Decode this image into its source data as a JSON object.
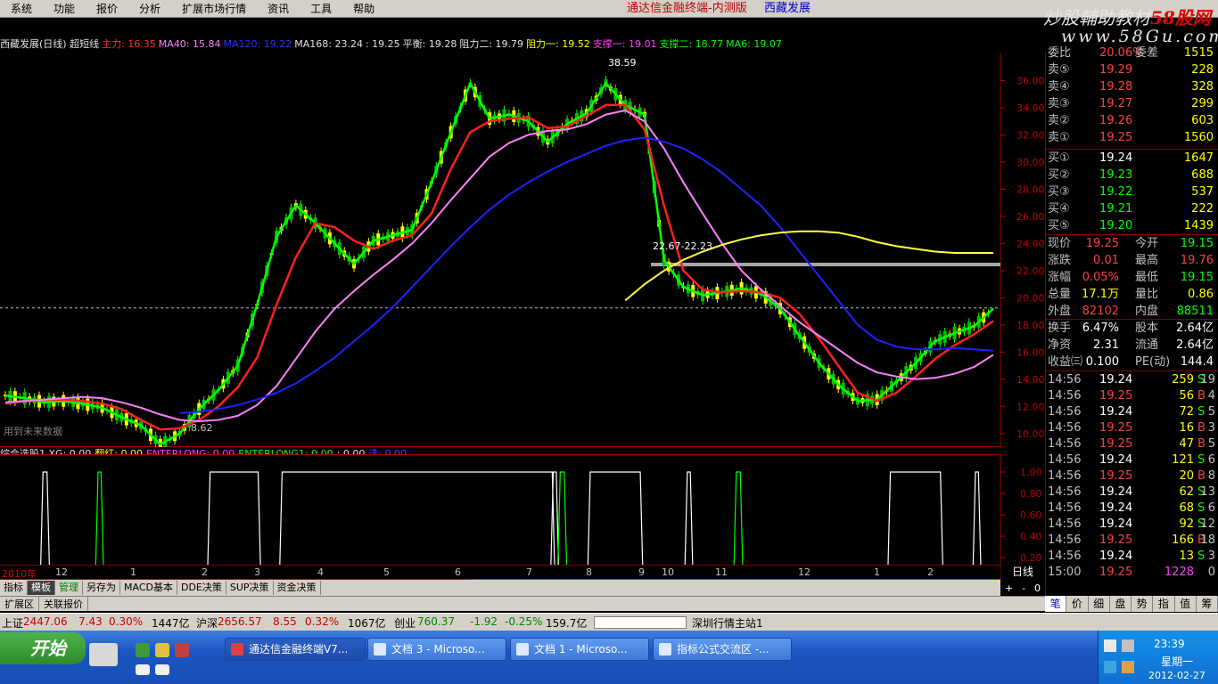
{
  "menu": {
    "items": [
      "系统",
      "功能",
      "报价",
      "分析",
      "扩展市场行情",
      "资讯",
      "工具",
      "帮助"
    ],
    "app_title": "通达信金融终端-内测版",
    "stock_name": "西藏发展"
  },
  "watermark": {
    "line1_a": "炒股輔助教材",
    "line1_b": "58股网",
    "line2": "www.58Gu.com"
  },
  "main_info": [
    {
      "text": "西藏发展(日线) 超短线",
      "color": "#e0e0e0"
    },
    {
      "text": "主力: 16.35",
      "color": "#ff3030"
    },
    {
      "text": "MA40: 15.84",
      "color": "#ff80ff"
    },
    {
      "text": "MA120: 19.22",
      "color": "#3030ff"
    },
    {
      "text": "MA168: 23.24",
      "color": "#e0e0e0"
    },
    {
      "text": ": 19.25",
      "color": "#e0e0e0"
    },
    {
      "text": "平衡: 19.28",
      "color": "#e0e0e0"
    },
    {
      "text": "阻力二: 19.79",
      "color": "#e0e0e0"
    },
    {
      "text": "阻力一: 19.52",
      "color": "#ffff00"
    },
    {
      "text": "支撑一: 19.01",
      "color": "#ff40ff"
    },
    {
      "text": "支撑二: 18.77",
      "color": "#00ff00"
    },
    {
      "text": "MA6: 19.07",
      "color": "#00ff00"
    }
  ],
  "chart_data": {
    "type": "line",
    "title": "西藏发展(日线) 超短线",
    "ylim": [
      9,
      38
    ],
    "y_ticks": [
      "36.00",
      "34.00",
      "32.00",
      "30.00",
      "28.00",
      "26.00",
      "24.00",
      "22.00",
      "20.00",
      "18.00",
      "16.00",
      "14.00",
      "12.00",
      "10.00"
    ],
    "x_ticks": [
      "2010年",
      "12",
      "1",
      "2",
      "3",
      "4",
      "5",
      "6",
      "7",
      "8",
      "9",
      "10",
      "11",
      "12",
      "1",
      "2"
    ],
    "annotations": [
      "38.59",
      "22.67-22.23",
      "8.62",
      "用到未来数据"
    ],
    "current_price": 19.25,
    "series": [
      {
        "name": "MA6",
        "color": "#00ff00",
        "values": [
          12.8,
          12.6,
          12.3,
          12.4,
          12.2,
          11.9,
          11.2,
          10.6,
          9.2,
          10.0,
          11.8,
          13.2,
          15.0,
          19.5,
          24.5,
          26.8,
          25.5,
          24.0,
          22.5,
          24.2,
          24.6,
          25.0,
          28.5,
          32.2,
          35.8,
          33.2,
          33.5,
          33.0,
          31.5,
          32.8,
          33.6,
          35.8,
          34.2,
          33.5,
          22.8,
          20.8,
          20.2,
          20.4,
          20.7,
          20.3,
          19.2,
          17.2,
          15.2,
          13.6,
          12.4,
          12.5,
          13.8,
          15.2,
          16.8,
          17.4,
          17.9,
          19.2
        ]
      },
      {
        "name": "主力",
        "color": "#ff2020",
        "values": [
          12.2,
          12.4,
          12.5,
          12.5,
          12.4,
          12.2,
          11.8,
          11.0,
          10.3,
          10.4,
          11.0,
          12.0,
          13.4,
          15.6,
          19.5,
          23.0,
          25.5,
          25.2,
          24.2,
          23.6,
          24.2,
          24.6,
          26.2,
          29.5,
          32.2,
          33.0,
          33.2,
          33.3,
          32.5,
          32.6,
          33.4,
          34.2,
          34.2,
          32.4,
          26.8,
          22.0,
          20.6,
          20.4,
          20.5,
          20.4,
          20.0,
          18.8,
          17.0,
          15.0,
          13.0,
          12.4,
          13.0,
          14.2,
          15.5,
          16.5,
          17.3,
          18.3
        ]
      },
      {
        "name": "MA40",
        "color": "#ff80ff",
        "values": [
          12.3,
          12.4,
          12.5,
          12.6,
          12.7,
          12.6,
          12.3,
          11.9,
          11.4,
          11.0,
          10.9,
          11.0,
          11.3,
          12.1,
          13.5,
          15.5,
          17.5,
          19.2,
          20.5,
          21.7,
          22.8,
          24.0,
          25.5,
          27.2,
          28.8,
          30.4,
          31.4,
          32.0,
          32.3,
          32.4,
          32.8,
          33.5,
          33.8,
          33.0,
          31.0,
          28.5,
          26.2,
          24.0,
          22.0,
          20.6,
          19.4,
          18.2,
          17.2,
          16.2,
          15.2,
          14.5,
          14.2,
          14.0,
          14.1,
          14.4,
          14.9,
          15.8
        ]
      },
      {
        "name": "MA120",
        "color": "#2020ff",
        "values": [
          null,
          null,
          null,
          null,
          null,
          null,
          null,
          null,
          null,
          11.5,
          11.6,
          11.8,
          12.1,
          12.5,
          13.0,
          13.7,
          14.6,
          15.6,
          16.8,
          18.0,
          19.3,
          20.8,
          22.3,
          23.8,
          25.2,
          26.5,
          27.6,
          28.5,
          29.3,
          30.0,
          30.6,
          31.2,
          31.6,
          31.8,
          31.5,
          31.0,
          30.2,
          29.2,
          28.0,
          26.8,
          25.2,
          23.4,
          21.6,
          19.8,
          18.0,
          16.9,
          16.4,
          16.2,
          16.2,
          16.3,
          16.2,
          16.1
        ]
      },
      {
        "name": "MA168",
        "color": "#ffff40",
        "values": [
          null,
          null,
          null,
          null,
          null,
          null,
          null,
          null,
          null,
          null,
          null,
          null,
          null,
          null,
          null,
          null,
          null,
          null,
          null,
          null,
          null,
          null,
          null,
          null,
          null,
          null,
          null,
          null,
          null,
          null,
          null,
          null,
          19.8,
          21.0,
          22.0,
          22.8,
          23.4,
          23.9,
          24.3,
          24.6,
          24.8,
          24.9,
          24.9,
          24.8,
          24.5,
          24.1,
          23.8,
          23.6,
          23.4,
          23.3,
          23.3,
          23.3
        ]
      }
    ],
    "sub_chart": {
      "indicator": "综合选股1",
      "ylim": [
        0,
        1.1
      ],
      "y_ticks": [
        "1.00",
        "0.80",
        "0.60",
        "0.40",
        "0.20"
      ],
      "signals": [
        {
          "from": 0.043,
          "to": 0.047,
          "color": "#ffffff"
        },
        {
          "from": 0.098,
          "to": 0.101,
          "color": "#00ff00"
        },
        {
          "from": 0.21,
          "to": 0.258,
          "color": "#ffffff"
        },
        {
          "from": 0.282,
          "to": 0.552,
          "color": "#ffffff"
        },
        {
          "from": 0.553,
          "to": 0.556,
          "color": "#ffffff"
        },
        {
          "from": 0.56,
          "to": 0.564,
          "color": "#00ff00"
        },
        {
          "from": 0.59,
          "to": 0.64,
          "color": "#ffffff"
        },
        {
          "from": 0.687,
          "to": 0.69,
          "color": "#ffffff"
        },
        {
          "from": 0.736,
          "to": 0.74,
          "color": "#00ff00"
        },
        {
          "from": 0.89,
          "to": 0.94,
          "color": "#ffffff"
        },
        {
          "from": 0.975,
          "to": 0.978,
          "color": "#ffffff"
        }
      ]
    }
  },
  "sub_info": [
    {
      "text": "综合选股1 XG: 0.00",
      "color": "#e0e0e0"
    },
    {
      "text": "翻红: 0.00",
      "color": "#ffff00"
    },
    {
      "text": "ENTERLONG: 0.00",
      "color": "#ff40ff"
    },
    {
      "text": "ENTERLONG1: 0.00",
      "color": "#00ff00"
    },
    {
      "text": ": 0.00",
      "color": "#e0e0e0"
    },
    {
      "text": "选: 0.00",
      "color": "#4040ff"
    }
  ],
  "tabs": [
    "指标",
    "模板",
    "管理",
    "另存为",
    "MACD基本",
    "DDE决策",
    "SUP决策",
    "资金决策"
  ],
  "tabs2": [
    "扩展区",
    "关联报价"
  ],
  "zoom_controls": [
    "+",
    "-",
    "0"
  ],
  "period_label": "日线",
  "orderbook": {
    "top_partial": {
      "label": "委比",
      "val": "20.06%",
      "label2": "委差",
      "val2": "1515"
    },
    "sells": [
      {
        "label": "卖⑤",
        "price": "19.29",
        "vol": "228"
      },
      {
        "label": "卖④",
        "price": "19.28",
        "vol": "328"
      },
      {
        "label": "卖③",
        "price": "19.27",
        "vol": "299"
      },
      {
        "label": "卖②",
        "price": "19.26",
        "vol": "603"
      },
      {
        "label": "卖①",
        "price": "19.25",
        "vol": "1560"
      }
    ],
    "buys": [
      {
        "label": "买①",
        "price": "19.24",
        "vol": "1647"
      },
      {
        "label": "买②",
        "price": "19.23",
        "vol": "688"
      },
      {
        "label": "买③",
        "price": "19.22",
        "vol": "537"
      },
      {
        "label": "买④",
        "price": "19.21",
        "vol": "222"
      },
      {
        "label": "买⑤",
        "price": "19.20",
        "vol": "1439"
      }
    ]
  },
  "stats": [
    {
      "a": "现价",
      "b": "19.25",
      "bc": "#ff4040",
      "c": "今开",
      "d": "19.15",
      "dc": "#00ff00"
    },
    {
      "a": "涨跌",
      "b": "0.01",
      "bc": "#ff4040",
      "c": "最高",
      "d": "19.76",
      "dc": "#ff4040"
    },
    {
      "a": "涨幅",
      "b": "0.05%",
      "bc": "#ff4040",
      "c": "最低",
      "d": "19.15",
      "dc": "#00ff00"
    },
    {
      "a": "总量",
      "b": "17.1万",
      "bc": "#ffff00",
      "c": "量比",
      "d": "0.86",
      "dc": "#ffff00"
    },
    {
      "a": "外盘",
      "b": "82102",
      "bc": "#ff4040",
      "c": "内盘",
      "d": "88511",
      "dc": "#00ff00"
    },
    {
      "a": "换手",
      "b": "6.47%",
      "bc": "#ffffff",
      "c": "股本",
      "d": "2.64亿",
      "dc": "#ffffff"
    },
    {
      "a": "净资",
      "b": "2.31",
      "bc": "#ffffff",
      "c": "流通",
      "d": "2.64亿",
      "dc": "#ffffff"
    },
    {
      "a": "收益㈢",
      "b": "0.100",
      "bc": "#ffffff",
      "c": "PE(动)",
      "d": "144.4",
      "dc": "#ffffff"
    }
  ],
  "ticks": [
    {
      "t": "14:56",
      "p": "19.24",
      "pc": "#ffffff",
      "v": "259",
      "s": "S",
      "sc": "#00ff00",
      "n": "19"
    },
    {
      "t": "14:56",
      "p": "19.25",
      "pc": "#ff4040",
      "v": "56",
      "s": "B",
      "sc": "#ff4040",
      "n": "4"
    },
    {
      "t": "14:56",
      "p": "19.24",
      "pc": "#ffffff",
      "v": "72",
      "s": "S",
      "sc": "#00ff00",
      "n": "5"
    },
    {
      "t": "14:56",
      "p": "19.25",
      "pc": "#ff4040",
      "v": "16",
      "s": "B",
      "sc": "#ff4040",
      "n": "3"
    },
    {
      "t": "14:56",
      "p": "19.25",
      "pc": "#ff4040",
      "v": "47",
      "s": "B",
      "sc": "#ff4040",
      "n": "5"
    },
    {
      "t": "14:56",
      "p": "19.24",
      "pc": "#ffffff",
      "v": "121",
      "s": "S",
      "sc": "#00ff00",
      "n": "6"
    },
    {
      "t": "14:56",
      "p": "19.25",
      "pc": "#ff4040",
      "v": "20",
      "s": "B",
      "sc": "#ff4040",
      "n": "8"
    },
    {
      "t": "14:56",
      "p": "19.24",
      "pc": "#ffffff",
      "v": "62",
      "s": "S",
      "sc": "#00ff00",
      "n": "13"
    },
    {
      "t": "14:56",
      "p": "19.24",
      "pc": "#ffffff",
      "v": "68",
      "s": "S",
      "sc": "#00ff00",
      "n": "6"
    },
    {
      "t": "14:56",
      "p": "19.24",
      "pc": "#ffffff",
      "v": "92",
      "s": "S",
      "sc": "#00ff00",
      "n": "12"
    },
    {
      "t": "14:56",
      "p": "19.25",
      "pc": "#ff4040",
      "v": "166",
      "s": "B",
      "sc": "#ff4040",
      "n": "18"
    },
    {
      "t": "14:56",
      "p": "19.24",
      "pc": "#ffffff",
      "v": "13",
      "s": "S",
      "sc": "#00ff00",
      "n": "3"
    },
    {
      "t": "15:00",
      "p": "19.25",
      "pc": "#ff4040",
      "v": "1228",
      "s": "",
      "sc": "#ff40ff",
      "n": "0"
    }
  ],
  "right_tabs": [
    "笔",
    "价",
    "细",
    "盘",
    "势",
    "指",
    "值",
    "筹"
  ],
  "statusbar": {
    "sh_label": "上证",
    "sh_val": "2447.06",
    "sh_chg": "7.43",
    "sh_pct": "0.30%",
    "sh_amt": "1447亿",
    "hs_label": "沪深",
    "hs_val": "2656.57",
    "hs_chg": "8.55",
    "hs_pct": "0.32%",
    "hs_amt": "1067亿",
    "cy_label": "创业",
    "cy_val": "760.37",
    "cy_chg": "-1.92",
    "cy_pct": "-0.25%",
    "cy_amt": "159.7亿",
    "server": "深圳行情主站1"
  },
  "taskbar": {
    "start": "开始",
    "buttons": [
      "通达信金融终端V7...",
      "文档 3 - Microso...",
      "文档 1 - Microso...",
      "指标公式交流区 -..."
    ],
    "time": "23:39",
    "weekday": "星期一",
    "date": "2012-02-27"
  }
}
